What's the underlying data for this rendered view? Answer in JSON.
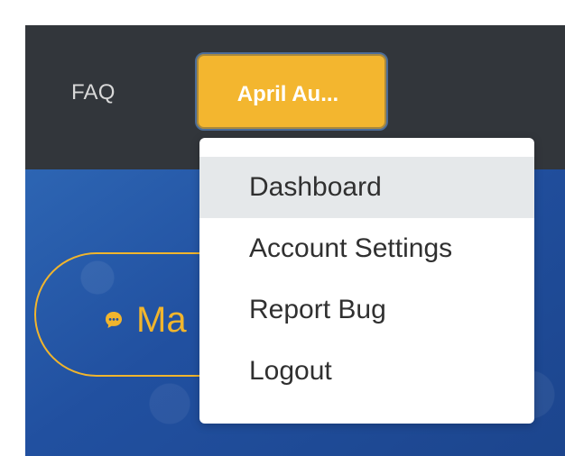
{
  "header": {
    "faq_label": "FAQ",
    "user_menu_label": "April Au..."
  },
  "hero": {
    "message_label": "Ma"
  },
  "dropdown": {
    "items": [
      {
        "label": "Dashboard",
        "selected": true
      },
      {
        "label": "Account Settings",
        "selected": false
      },
      {
        "label": "Report Bug",
        "selected": false
      },
      {
        "label": "Logout",
        "selected": false
      }
    ]
  },
  "colors": {
    "header_background": "#32363b",
    "primary_blue": "#2150a0",
    "accent_yellow": "#f3b62f",
    "menu_selected_background": "#e5e8ea"
  },
  "icons": {
    "message_icon": "chat-bubble-icon"
  }
}
